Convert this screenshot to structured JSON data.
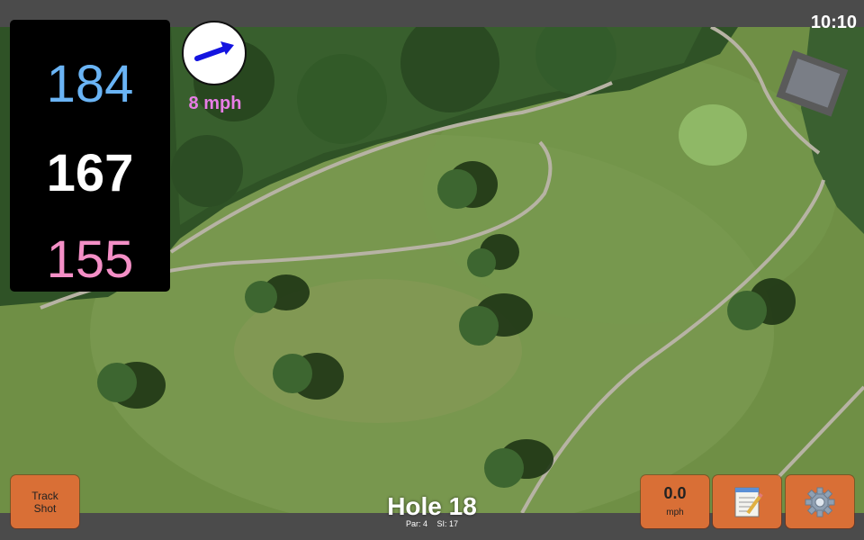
{
  "status": {
    "time": "10:10"
  },
  "yardage": {
    "back": "184",
    "center": "167",
    "front": "155"
  },
  "wind": {
    "speed_label": "8 mph",
    "direction_icon": "arrow-icon"
  },
  "hole": {
    "title": "Hole 18",
    "par": "Par: 4",
    "si": "SI: 17"
  },
  "buttons": {
    "track_shot": "Track\nShot",
    "speed_value": "0.0",
    "speed_unit": "mph",
    "notes_icon": "notepad-icon",
    "settings_icon": "gear-icon"
  },
  "colors": {
    "back": "#6ab4f5",
    "center": "#ffffff",
    "front": "#f48fc6",
    "wind_text": "#e87de6",
    "button": "#d96f36"
  }
}
